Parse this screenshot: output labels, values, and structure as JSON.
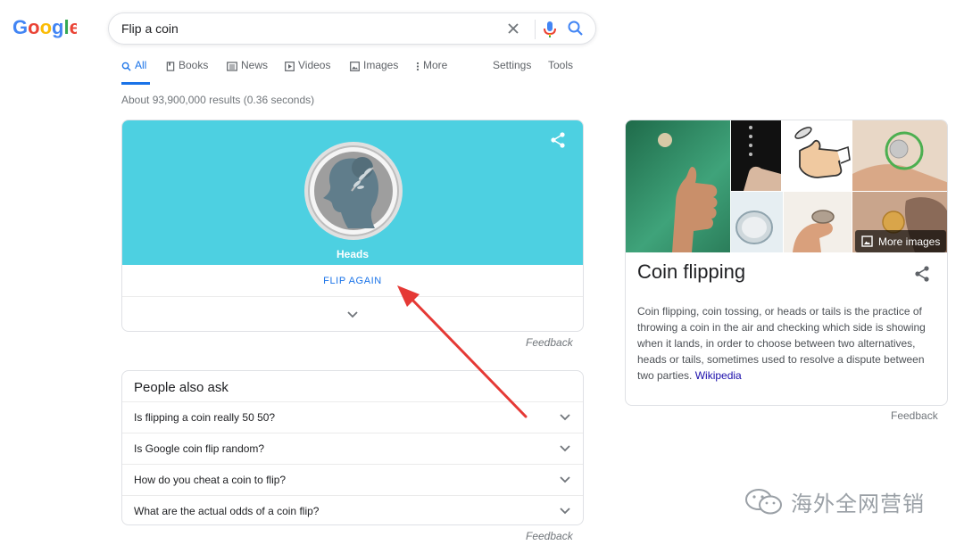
{
  "search": {
    "query": "Flip a coin"
  },
  "tabs": [
    {
      "label": "All",
      "icon": "search-icon",
      "active": true
    },
    {
      "label": "Books",
      "icon": "book-icon"
    },
    {
      "label": "News",
      "icon": "news-icon"
    },
    {
      "label": "Videos",
      "icon": "video-icon"
    },
    {
      "label": "Images",
      "icon": "image-icon"
    },
    {
      "label": "More",
      "icon": "more-vertical-icon"
    },
    {
      "label": "Settings"
    },
    {
      "label": "Tools"
    }
  ],
  "result_stats": "About 93,900,000 results (0.36 seconds)",
  "coin_card": {
    "result_label": "Heads",
    "flip_again_label": "FLIP AGAIN",
    "feedback_label": "Feedback",
    "stage_color": "#4dd0e1"
  },
  "people_also_ask": {
    "title": "People also ask",
    "questions": [
      "Is flipping a coin really 50 50?",
      "Is Google coin flip random?",
      "How do you cheat a coin to flip?",
      "What are the actual odds of a coin flip?"
    ],
    "feedback_label": "Feedback"
  },
  "knowledge_panel": {
    "more_images_label": "More images",
    "title": "Coin flipping",
    "description": "Coin flipping, coin tossing, or heads or tails is the practice of throwing a coin in the air and checking which side is showing when it lands, in order to choose between two alternatives, heads or tails, sometimes used to resolve a dispute between two parties.",
    "source_link": "Wikipedia",
    "feedback_label": "Feedback"
  },
  "watermark": {
    "text": "海外全网营销"
  },
  "colors": {
    "accent_blue": "#1a73e8",
    "annotation_red": "#e53935"
  }
}
